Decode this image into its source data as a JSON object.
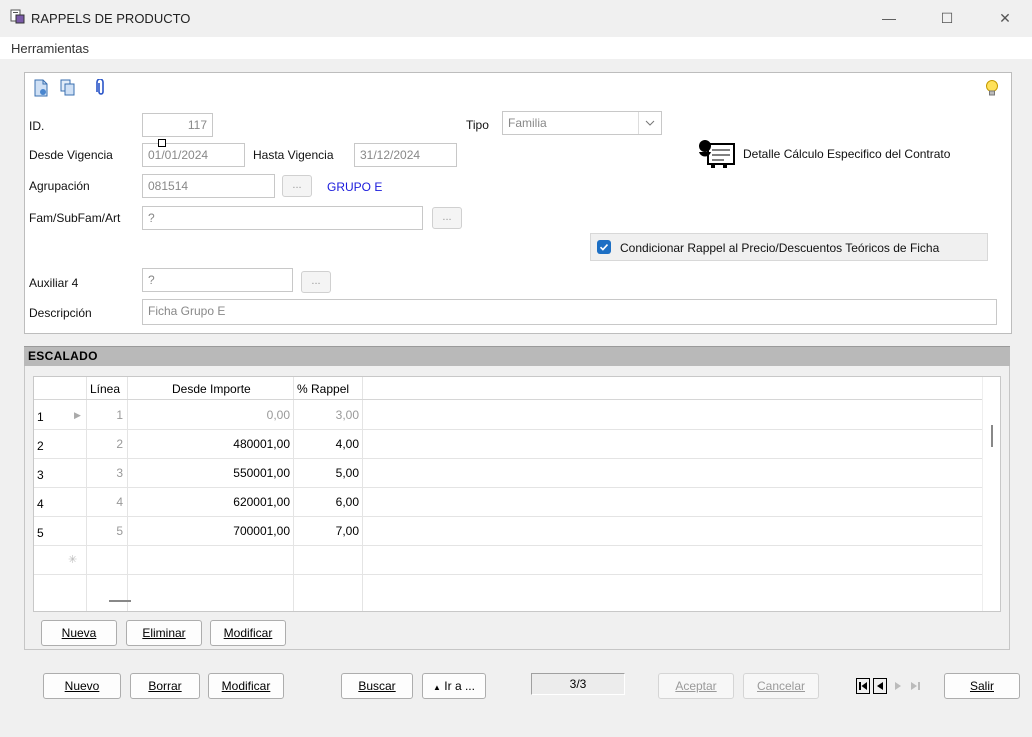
{
  "window": {
    "title": "RAPPELS DE PRODUCTO"
  },
  "menu": {
    "tools": "Herramientas"
  },
  "form": {
    "id_label": "ID.",
    "id_value": "117",
    "tipo_label": "Tipo",
    "tipo_value": "Familia",
    "desde_label": "Desde Vigencia",
    "desde_value": "01/01/2024",
    "hasta_label": "Hasta Vigencia",
    "hasta_value": "31/12/2024",
    "agrupacion_label": "Agrupación",
    "agrupacion_value": "081514",
    "agrupacion_name": "GRUPO E",
    "fam_label": "Fam/SubFam/Art",
    "fam_value": "?",
    "aux_label": "Auxiliar 4",
    "aux_value": "?",
    "desc_label": "Descripción",
    "desc_value": "Ficha Grupo E",
    "ellipsis": "...",
    "detalle_label": "Detalle Cálculo Especifico del Contrato",
    "condicionar_label": "Condicionar Rappel al Precio/Descuentos Teóricos de Ficha",
    "condicionar_checked": true
  },
  "grid": {
    "section_title": "ESCALADO",
    "columns": [
      "Línea",
      "Desde Importe",
      "% Rappel"
    ],
    "rows": [
      {
        "n": "1",
        "linea": "1",
        "importe": "0,00",
        "rappel": "3,00"
      },
      {
        "n": "2",
        "linea": "2",
        "importe": "480001,00",
        "rappel": "4,00"
      },
      {
        "n": "3",
        "linea": "3",
        "importe": "550001,00",
        "rappel": "5,00"
      },
      {
        "n": "4",
        "linea": "4",
        "importe": "620001,00",
        "rappel": "6,00"
      },
      {
        "n": "5",
        "linea": "5",
        "importe": "700001,00",
        "rappel": "7,00"
      }
    ],
    "buttons": {
      "nueva": "Nueva",
      "eliminar": "Eliminar",
      "modificar": "Modificar"
    }
  },
  "footer": {
    "nuevo": "Nuevo",
    "borrar": "Borrar",
    "modificar": "Modificar",
    "buscar": "Buscar",
    "ir_a": "Ir a ...",
    "record_counter": "3/3",
    "aceptar": "Aceptar",
    "cancelar": "Cancelar",
    "salir": "Salir"
  },
  "colors": {
    "link_blue": "#1a1adc",
    "checkbox_blue": "#1d6fc4"
  }
}
